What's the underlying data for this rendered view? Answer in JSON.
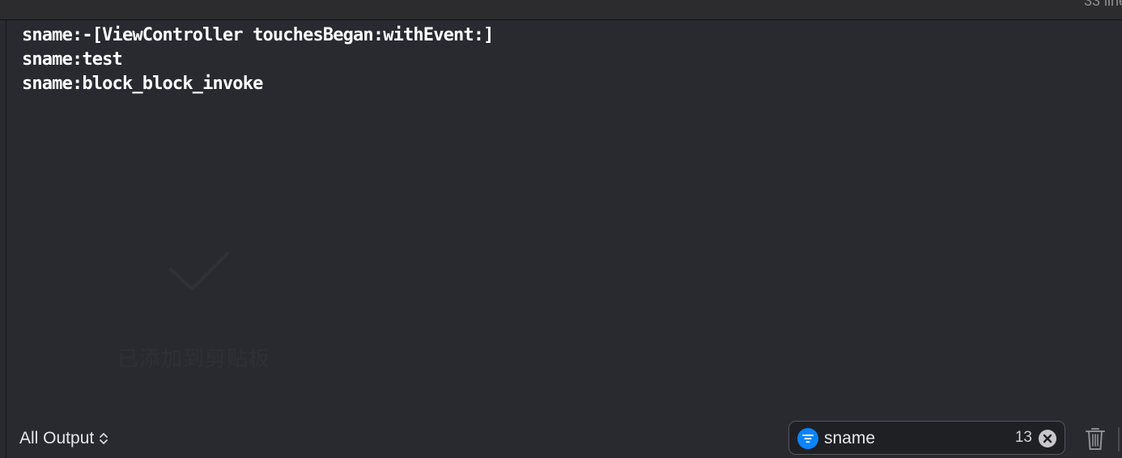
{
  "header": {
    "line_count": "33 line"
  },
  "console": {
    "lines": [
      "sname:-[ViewController touchesBegan:withEvent:]",
      "sname:test",
      "sname:block_block_invoke"
    ]
  },
  "watermark": {
    "text": "已添加到剪贴板"
  },
  "footer": {
    "output_selector_label": "All Output",
    "filter_value": "sname",
    "match_count": "13"
  },
  "icons": {
    "filter": "filter-icon",
    "clear": "clear-icon",
    "trash": "trash-icon",
    "selector": "chevron-up-down-icon",
    "watermark": "checkmark-icon"
  },
  "colors": {
    "background": "#292a30",
    "text": "#ffffff",
    "accent": "#0a84ff"
  }
}
